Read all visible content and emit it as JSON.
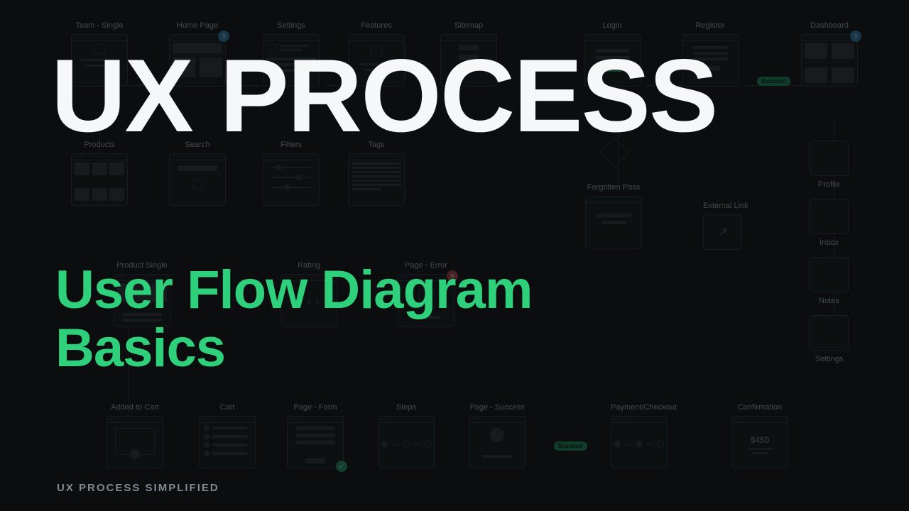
{
  "overlay": {
    "main_title": "UX PROCESS",
    "subtitle_line1": "User Flow Diagram",
    "subtitle_line2": "Basics",
    "footer": "UX PROCESS SIMPLIFIED"
  },
  "badges": {
    "home_page": "3",
    "dashboard": "3"
  },
  "pills": {
    "login_success": "Success!",
    "payment_success": "Success!"
  },
  "confirmation_card": {
    "amount": "$450"
  },
  "nodes": {
    "row1": [
      {
        "id": "team-single",
        "label": "Team - Single"
      },
      {
        "id": "home-page",
        "label": "Home Page"
      },
      {
        "id": "settings",
        "label": "Settings"
      },
      {
        "id": "features",
        "label": "Features"
      },
      {
        "id": "sitemap",
        "label": "Sitemap"
      },
      {
        "id": "login",
        "label": "Login"
      },
      {
        "id": "register",
        "label": "Register"
      },
      {
        "id": "dashboard",
        "label": "Dashboard"
      }
    ],
    "row2": [
      {
        "id": "products",
        "label": "Products"
      },
      {
        "id": "search",
        "label": "Search"
      },
      {
        "id": "filters",
        "label": "Filters"
      },
      {
        "id": "tags",
        "label": "Tags"
      },
      {
        "id": "forgotten-pass",
        "label": "Forgotten Pass"
      },
      {
        "id": "external-link",
        "label": "External Link"
      }
    ],
    "row3": [
      {
        "id": "product-single",
        "label": "Product Single"
      },
      {
        "id": "rating",
        "label": "Rating"
      },
      {
        "id": "page-error",
        "label": "Page - Error"
      }
    ],
    "row4": [
      {
        "id": "added-to-cart",
        "label": "Added to Cart"
      },
      {
        "id": "cart",
        "label": "Cart"
      },
      {
        "id": "page-form",
        "label": "Page - Form"
      },
      {
        "id": "steps",
        "label": "Steps"
      },
      {
        "id": "page-success",
        "label": "Page - Success"
      },
      {
        "id": "payment-checkout",
        "label": "Payment/Checkout"
      },
      {
        "id": "confirmation",
        "label": "Confirmation"
      }
    ],
    "side": [
      {
        "id": "profile",
        "label": "Profile"
      },
      {
        "id": "inbox",
        "label": "Inbox"
      },
      {
        "id": "notes",
        "label": "Notes"
      },
      {
        "id": "settings2",
        "label": "Settings"
      }
    ]
  }
}
